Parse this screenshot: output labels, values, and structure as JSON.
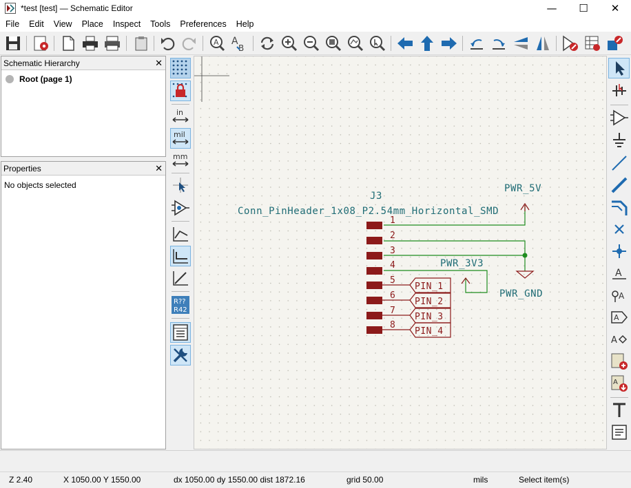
{
  "window": {
    "title": "*test [test] — Schematic Editor",
    "controls": {
      "minimize": "—",
      "maximize": "☐",
      "close": "✕"
    }
  },
  "menu": [
    "File",
    "Edit",
    "View",
    "Place",
    "Inspect",
    "Tools",
    "Preferences",
    "Help"
  ],
  "panels": {
    "hierarchy": {
      "title": "Schematic Hierarchy",
      "root": "Root (page 1)",
      "close": "✕"
    },
    "properties": {
      "title": "Properties",
      "empty": "No objects selected",
      "close": "✕"
    }
  },
  "left_toolbar": {
    "unit_in": "in",
    "unit_mil": "mil",
    "unit_mm": "mm",
    "annotate_top": "R??",
    "annotate_bottom": "R42"
  },
  "schematic": {
    "reference": "J3",
    "value": "Conn_PinHeader_1x08_P2.54mm_Horizontal_SMD",
    "pins": [
      "1",
      "2",
      "3",
      "4",
      "5",
      "6",
      "7",
      "8"
    ],
    "power": {
      "p5v": "PWR_5V",
      "p3v3": "PWR_3V3",
      "gnd": "PWR_GND"
    },
    "labels": [
      "PIN_1",
      "PIN_2",
      "PIN_3",
      "PIN_4"
    ],
    "colors": {
      "wire": "#1f8c1f",
      "symbol": "#8c1a1a",
      "text": "#1f6c75",
      "junction": "#1f8c1f"
    }
  },
  "status": {
    "zoom": "Z 2.40",
    "coords": "X 1050.00  Y 1550.00",
    "delta": "dx 1050.00  dy 1550.00  dist 1872.16",
    "grid": "grid 50.00",
    "units": "mils",
    "mode": "Select item(s)"
  }
}
